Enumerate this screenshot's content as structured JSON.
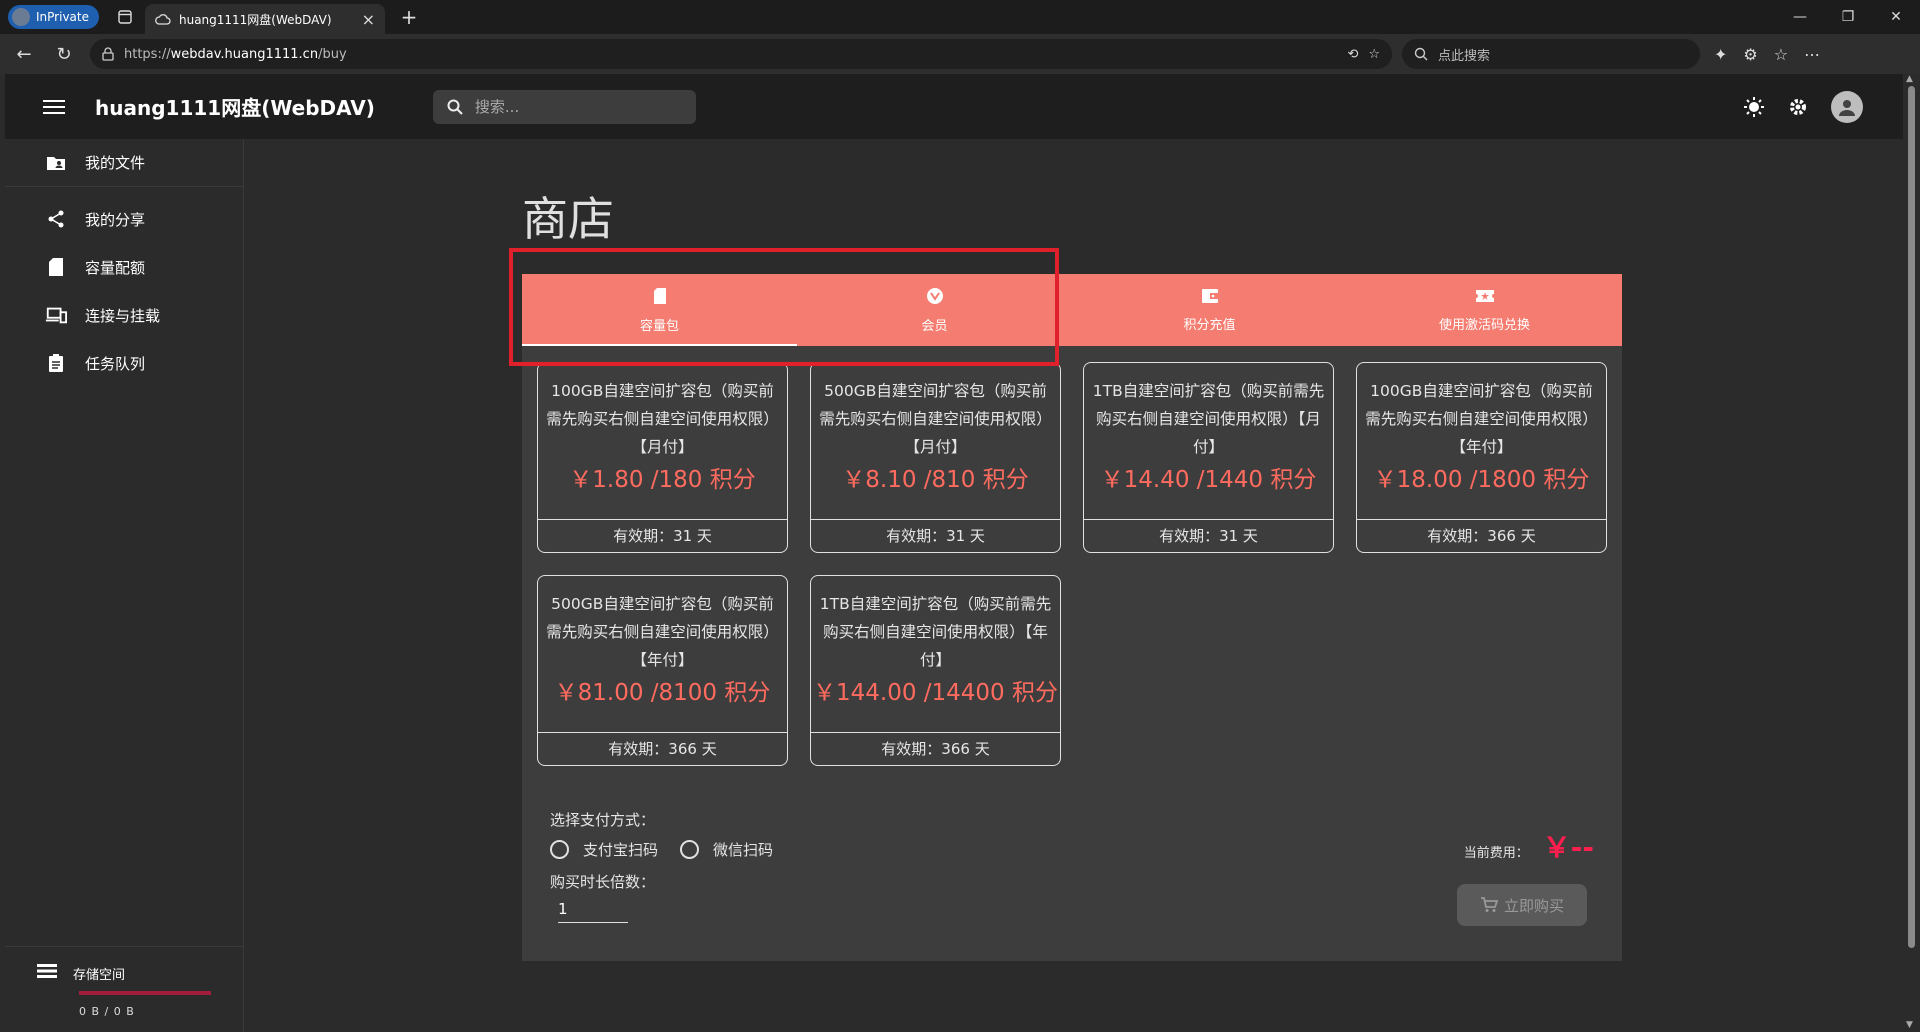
{
  "browser": {
    "inprivate_label": "InPrivate",
    "tab_title": "huang1111网盘(WebDAV)",
    "url_scheme": "https://",
    "url_host": "webdav.huang1111.cn",
    "url_path": "/buy",
    "search_placeholder": "点此搜索",
    "new_tab": "+",
    "tab_close": "×"
  },
  "app": {
    "title": "huang1111网盘(WebDAV)",
    "search_placeholder": "搜索..."
  },
  "sidebar": {
    "items": [
      {
        "label": "我的文件",
        "icon": "folder-user-icon"
      },
      {
        "label": "我的分享",
        "icon": "share-icon"
      },
      {
        "label": "容量配额",
        "icon": "sd-card-icon"
      },
      {
        "label": "连接与挂载",
        "icon": "devices-icon"
      },
      {
        "label": "任务队列",
        "icon": "clipboard-icon"
      }
    ],
    "storage": {
      "label": "存储空间",
      "usage": "0 B / 0 B"
    }
  },
  "page": {
    "title": "商店"
  },
  "tabs": [
    {
      "label": "容量包",
      "icon": "sd-card-icon",
      "active": true
    },
    {
      "label": "会员",
      "icon": "vip-icon",
      "active": false
    },
    {
      "label": "积分充值",
      "icon": "wallet-icon",
      "active": false
    },
    {
      "label": "使用激活码兑换",
      "icon": "ticket-icon",
      "active": false
    }
  ],
  "cards": [
    {
      "desc": "100GB自建空间扩容包（购买前需先购买右侧自建空间使用权限）【月付】",
      "price": "￥1.80 /180 积分",
      "validity": "有效期：31 天"
    },
    {
      "desc": "500GB自建空间扩容包（购买前需先购买右侧自建空间使用权限）【月付】",
      "price": "￥8.10 /810 积分",
      "validity": "有效期：31 天"
    },
    {
      "desc": "1TB自建空间扩容包（购买前需先购买右侧自建空间使用权限）【月付】",
      "price": "￥14.40 /1440 积分",
      "validity": "有效期：31 天"
    },
    {
      "desc": "100GB自建空间扩容包（购买前需先购买右侧自建空间使用权限）【年付】",
      "price": "￥18.00 /1800 积分",
      "validity": "有效期：366 天"
    },
    {
      "desc": "500GB自建空间扩容包（购买前需先购买右侧自建空间使用权限）【年付】",
      "price": "￥81.00 /8100 积分",
      "validity": "有效期：366 天"
    },
    {
      "desc": "1TB自建空间扩容包（购买前需先购买右侧自建空间使用权限）【年付】",
      "price": "￥144.00 /14400 积分",
      "validity": "有效期：366 天"
    }
  ],
  "payment": {
    "label": "选择支付方式：",
    "options": [
      "支付宝扫码",
      "微信扫码"
    ],
    "multiplier_label": "购买时长倍数：",
    "multiplier_value": "1",
    "cost_label": "当前费用：",
    "cost_value": "￥--",
    "buy_label": "立即购买"
  },
  "colors": {
    "tab_bar": "#f57c70",
    "price": "#ff6b5f",
    "cost": "#ff1f4e",
    "highlight_box": "#e0202a"
  }
}
